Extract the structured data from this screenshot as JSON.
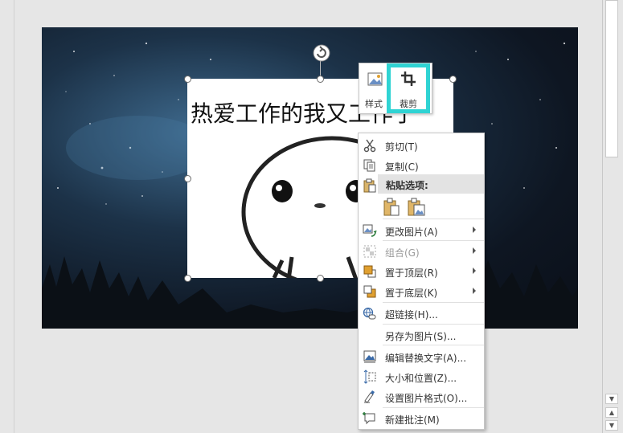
{
  "toolbar": {
    "style_label": "样式",
    "crop_label": "裁剪"
  },
  "picture": {
    "caption": "热爱工作的我又工作了"
  },
  "context_menu": {
    "items": [
      {
        "label": "剪切(T)",
        "icon": "scissors-icon"
      },
      {
        "label": "复制(C)",
        "icon": "copy-icon"
      },
      {
        "label": "粘贴选项:",
        "icon": "clipboard-icon"
      },
      {
        "label": "更改图片(A)",
        "icon": "change-picture-icon",
        "submenu": true
      },
      {
        "label": "组合(G)",
        "icon": "group-icon",
        "submenu": true,
        "disabled": true
      },
      {
        "label": "置于顶层(R)",
        "icon": "bring-to-front-icon",
        "submenu": true
      },
      {
        "label": "置于底层(K)",
        "icon": "send-to-back-icon",
        "submenu": true
      },
      {
        "label": "超链接(H)...",
        "icon": "hyperlink-icon"
      },
      {
        "label": "另存为图片(S)...",
        "icon": ""
      },
      {
        "label": "编辑替换文字(A)...",
        "icon": "alt-text-icon"
      },
      {
        "label": "大小和位置(Z)...",
        "icon": "size-position-icon"
      },
      {
        "label": "设置图片格式(O)...",
        "icon": "format-picture-icon"
      },
      {
        "label": "新建批注(M)",
        "icon": "new-comment-icon"
      }
    ],
    "paste_options": [
      "paste-keep-formatting-icon",
      "paste-as-picture-icon"
    ]
  },
  "colors": {
    "highlight": "#2fd3d3",
    "menu_hover": "#e3e3e3",
    "disabled_text": "#9a9a9a"
  }
}
